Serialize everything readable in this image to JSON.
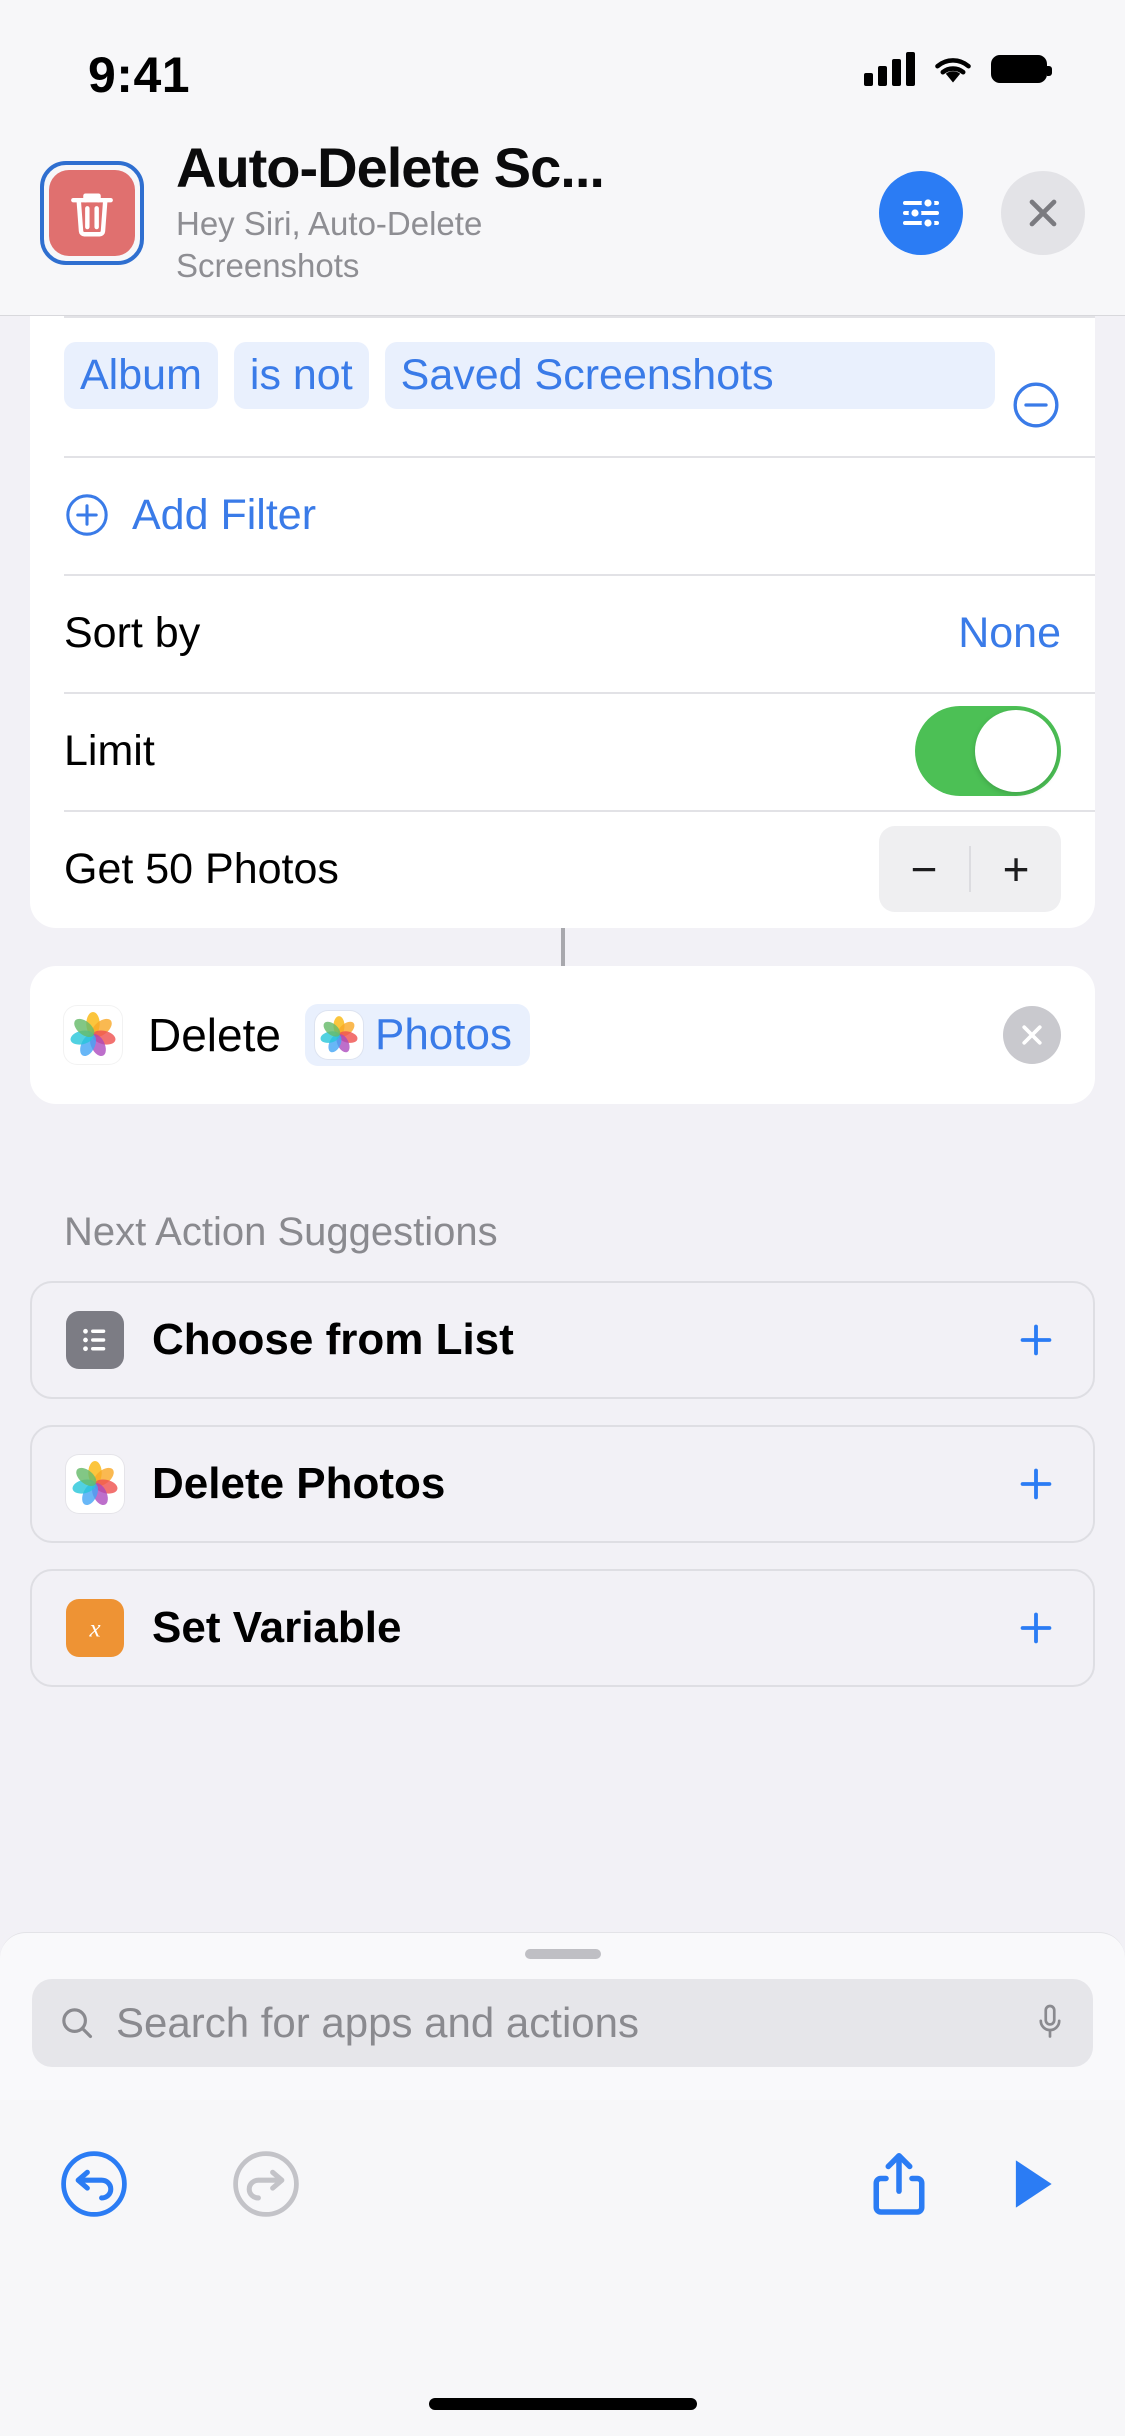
{
  "status_bar": {
    "time": "9:41",
    "cellular_icon": "signal-bars-icon",
    "wifi_icon": "wifi-icon",
    "battery_icon": "battery-full-icon"
  },
  "header": {
    "shortcut_icon": "trash-icon",
    "title": "Auto-Delete Sc...",
    "subtitle": "Hey Siri, Auto-Delete Screenshots",
    "settings_button": "shortcut-settings-icon",
    "close_button": "close-icon",
    "accent_blue": "#2B7CF4",
    "icon_red": "#E0706F"
  },
  "find_photos_card": {
    "filter": {
      "attribute": "Album",
      "operator": "is not",
      "value": "Saved Screenshots",
      "remove_icon": "minus-circle-icon"
    },
    "add_filter": {
      "label": "Add Filter",
      "icon": "plus-circle-icon"
    },
    "sort_by": {
      "label": "Sort by",
      "value": "None"
    },
    "limit": {
      "label": "Limit",
      "toggle_on": true,
      "toggle_color": "#4CC055"
    },
    "get_photos": {
      "label": "Get 50 Photos",
      "count": 50,
      "minus_label": "−",
      "plus_label": "+"
    }
  },
  "delete_action": {
    "app_icon": "photos-app-icon",
    "label": "Delete",
    "token_icon": "photos-app-icon",
    "token_label": "Photos",
    "remove_icon": "close-circle-icon"
  },
  "suggestions": {
    "title": "Next Action Suggestions",
    "items": [
      {
        "label": "Choose from List",
        "icon": "list-icon",
        "icon_style": "list",
        "add_icon": "plus-icon"
      },
      {
        "label": "Delete Photos",
        "icon": "photos-app-icon",
        "icon_style": "photos",
        "add_icon": "plus-icon"
      },
      {
        "label": "Set Variable",
        "icon": "variable-x-icon",
        "icon_style": "var",
        "add_icon": "plus-icon"
      }
    ]
  },
  "search": {
    "placeholder": "Search for apps and actions",
    "value": "",
    "search_icon": "search-icon",
    "mic_icon": "microphone-icon"
  },
  "toolbar": {
    "undo": {
      "icon": "undo-icon",
      "enabled": true
    },
    "redo": {
      "icon": "redo-icon",
      "enabled": false
    },
    "share": {
      "icon": "share-icon",
      "enabled": true
    },
    "play": {
      "icon": "play-icon",
      "enabled": true
    }
  }
}
